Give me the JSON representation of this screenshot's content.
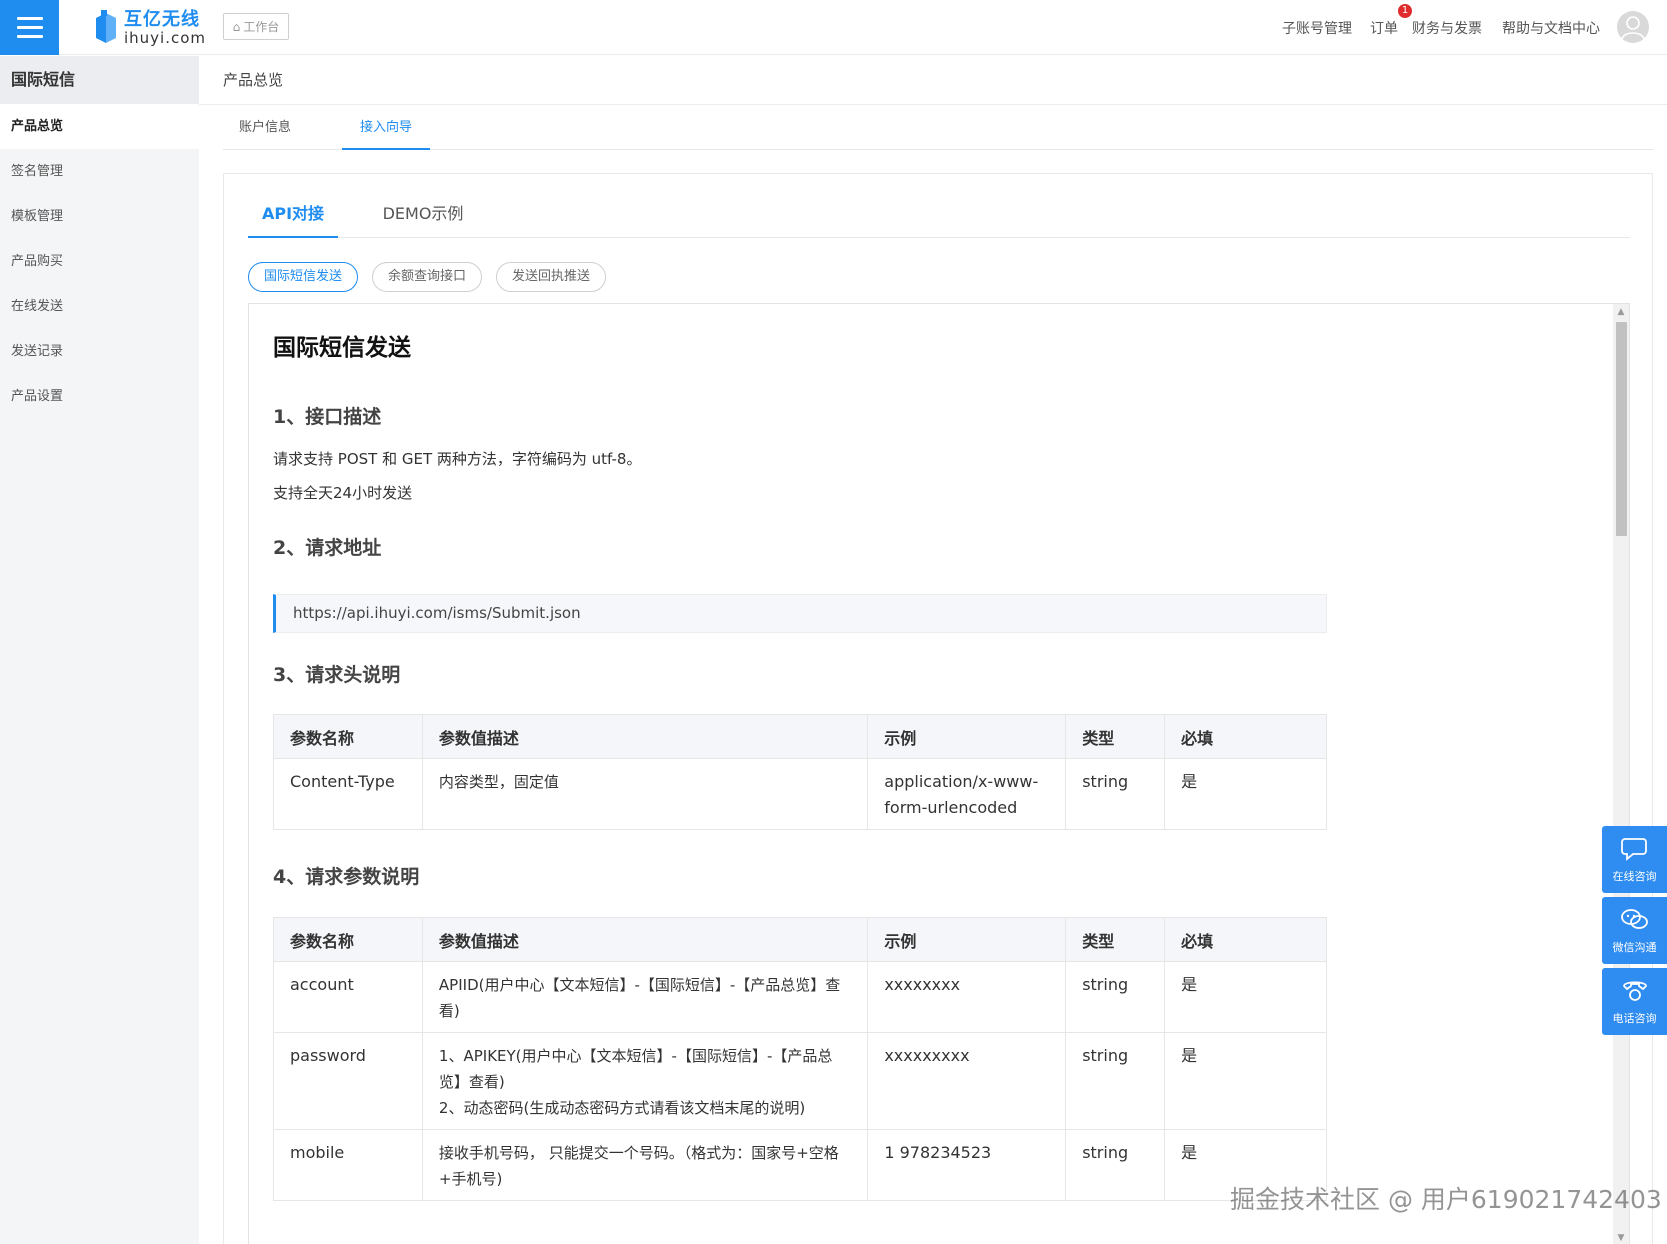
{
  "topbar": {
    "logo_cn": "互亿无线",
    "logo_en": "ihuyi.com",
    "workbench": "工作台",
    "nav": [
      "子账号管理",
      "订单",
      "财务与发票",
      "帮助与文档中心"
    ],
    "order_badge": "1"
  },
  "sidebar": {
    "title": "国际短信",
    "items": [
      "产品总览",
      "签名管理",
      "模板管理",
      "产品购买",
      "在线发送",
      "发送记录",
      "产品设置"
    ]
  },
  "breadcrumb": "产品总览",
  "subtabs": [
    "账户信息",
    "接入向导"
  ],
  "api_tabs": [
    "API对接",
    "DEMO示例"
  ],
  "pills": [
    "国际短信发送",
    "余额查询接口",
    "发送回执推送"
  ],
  "doc": {
    "title": "国际短信发送",
    "s1_title": "1、接口描述",
    "s1_p1": "请求支持 POST 和 GET 两种方法，字符编码为 utf-8。",
    "s1_p2": "支持全天24小时发送",
    "s2_title": "2、请求地址",
    "url": "https://api.ihuyi.com/isms/Submit.json",
    "s3_title": "3、请求头说明",
    "s4_title": "4、请求参数说明",
    "headers": [
      "参数名称",
      "参数值描述",
      "示例",
      "类型",
      "必填"
    ],
    "header_rows": [
      {
        "name": "Content-Type",
        "desc": "内容类型，固定值",
        "example": "application/x-www-form-urlencoded",
        "type": "string",
        "required": "是"
      }
    ],
    "param_rows": [
      {
        "name": "account",
        "desc": "APIID(用户中心【文本短信】-【国际短信】-【产品总览】查看)",
        "desc2": "",
        "example": "xxxxxxxx",
        "type": "string",
        "required": "是"
      },
      {
        "name": "password",
        "desc": "1、APIKEY(用户中心【文本短信】-【国际短信】-【产品总览】查看)",
        "desc2": "2、动态密码(生成动态密码方式请看该文档末尾的说明)",
        "example": "xxxxxxxxx",
        "type": "string",
        "required": "是"
      },
      {
        "name": "mobile",
        "desc": "接收手机号码， 只能提交一个号码。（格式为：国家号+空格+手机号)",
        "desc2": "",
        "example": "1 978234523",
        "type": "string",
        "required": "是"
      }
    ]
  },
  "float_widget": [
    "在线咨询",
    "微信沟通",
    "电话咨询"
  ],
  "watermark": "掘金技术社区 @ 用户619021742403",
  "colors": {
    "accent": "#1f8cf0",
    "badge": "#e02c2c"
  }
}
